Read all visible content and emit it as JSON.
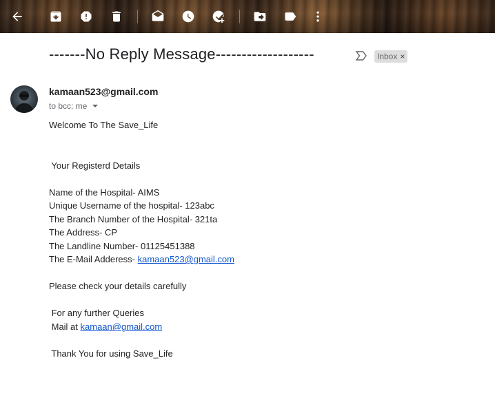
{
  "toolbar": {
    "icons": [
      "back-arrow-icon",
      "archive-icon",
      "report-spam-icon",
      "delete-icon",
      "mark-unread-icon",
      "snooze-icon",
      "add-task-icon",
      "move-to-icon",
      "label-icon",
      "more-options-icon"
    ]
  },
  "subject": {
    "text": "-------No Reply Message-------------------",
    "label": "Inbox",
    "label_close": "×"
  },
  "sender": {
    "email": "kamaan523@gmail.com",
    "recipients": "to bcc: me"
  },
  "body": {
    "welcome": "Welcome To The Save_Life",
    "registered_heading": " Your Registerd Details",
    "hospital_name": "Name of the Hospital- AIMS",
    "username": "Unique Username of the hospital- 123abc",
    "branch_number": "The Branch Number of the Hospital- 321ta",
    "address": "The Address- CP",
    "landline": "The Landline Number- 01125451388",
    "email_label": "The E-Mail Adderess- ",
    "email_link": "kamaan523@gmail.com",
    "check_details": "Please check your details carefully",
    "queries": " For any further Queries",
    "mail_at_label": " Mail at ",
    "mail_at_link": "kamaan@gmail.com",
    "thanks": " Thank You for using Save_Life"
  }
}
